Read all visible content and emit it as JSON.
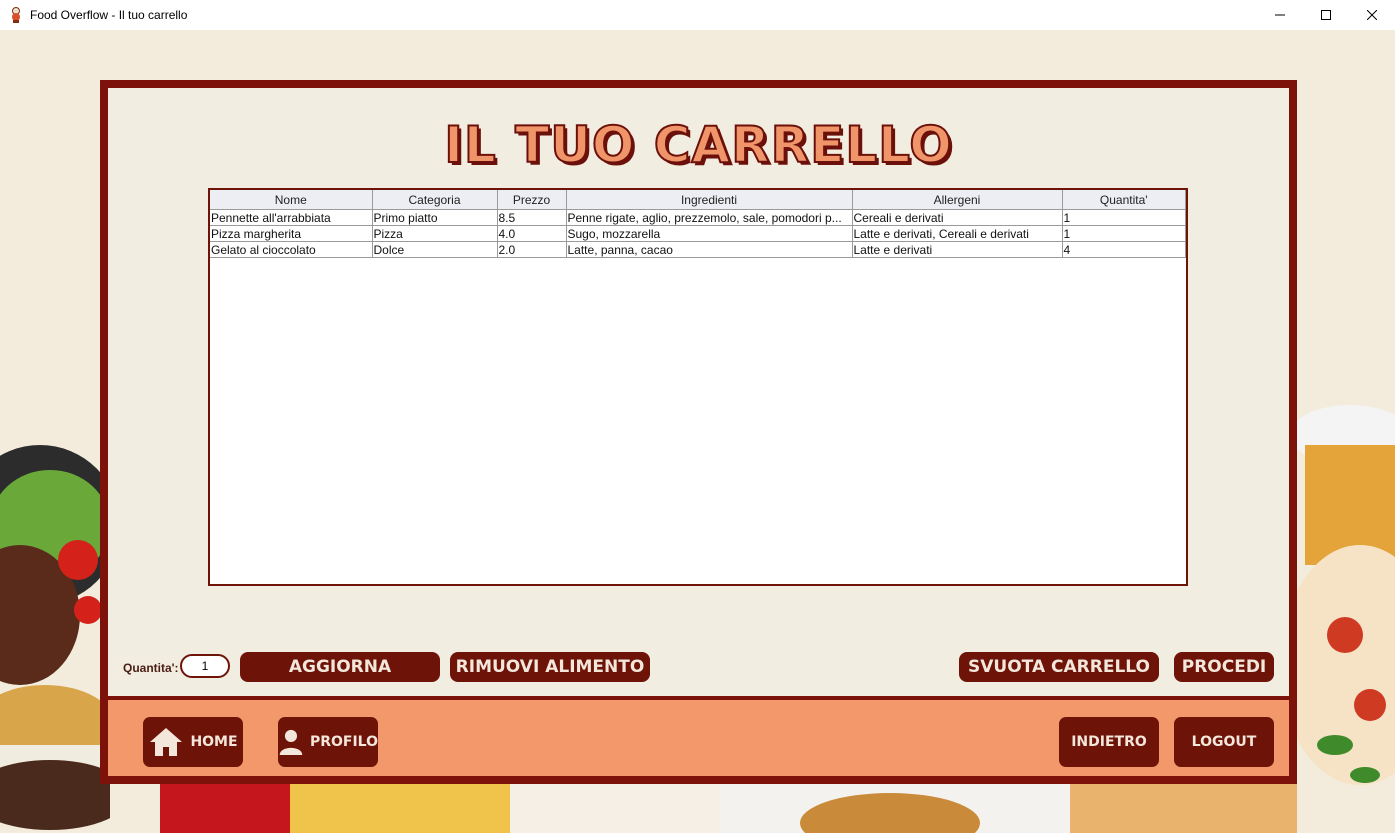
{
  "window": {
    "title": "Food Overflow - Il tuo carrello",
    "minimize": "—",
    "maximize": "☐",
    "close": "✕"
  },
  "page": {
    "title": "IL TUO CARRELLO"
  },
  "table": {
    "headers": [
      "Nome",
      "Categoria",
      "Prezzo",
      "Ingredienti",
      "Allergeni",
      "Quantita'"
    ],
    "rows": [
      [
        "Pennette all'arrabbiata",
        "Primo piatto",
        "8.5",
        "Penne rigate, aglio, prezzemolo, sale, pomodori p...",
        "Cereali e derivati",
        "1"
      ],
      [
        "Pizza margherita",
        "Pizza",
        "4.0",
        "Sugo, mozzarella",
        "Latte e derivati, Cereali e derivati",
        "1"
      ],
      [
        "Gelato al cioccolato",
        "Dolce",
        "2.0",
        "Latte, panna, cacao",
        "Latte e derivati",
        "4"
      ]
    ]
  },
  "actions": {
    "quantity_label": "Quantita':",
    "quantity_value": "1",
    "update_label": "AGGIORNA",
    "remove_label": "RIMUOVI ALIMENTO",
    "empty_label": "SVUOTA CARRELLO",
    "proceed_label": "PROCEDI"
  },
  "nav": {
    "home_label": "HOME",
    "profile_label": "PROFILO",
    "back_label": "INDIETRO",
    "logout_label": "LOGOUT"
  },
  "colors": {
    "frame": "#7c1209",
    "button": "#6e1308",
    "nav_bar": "#f3986a",
    "panel": "#f2ede1",
    "title_fill": "#f0956a"
  }
}
